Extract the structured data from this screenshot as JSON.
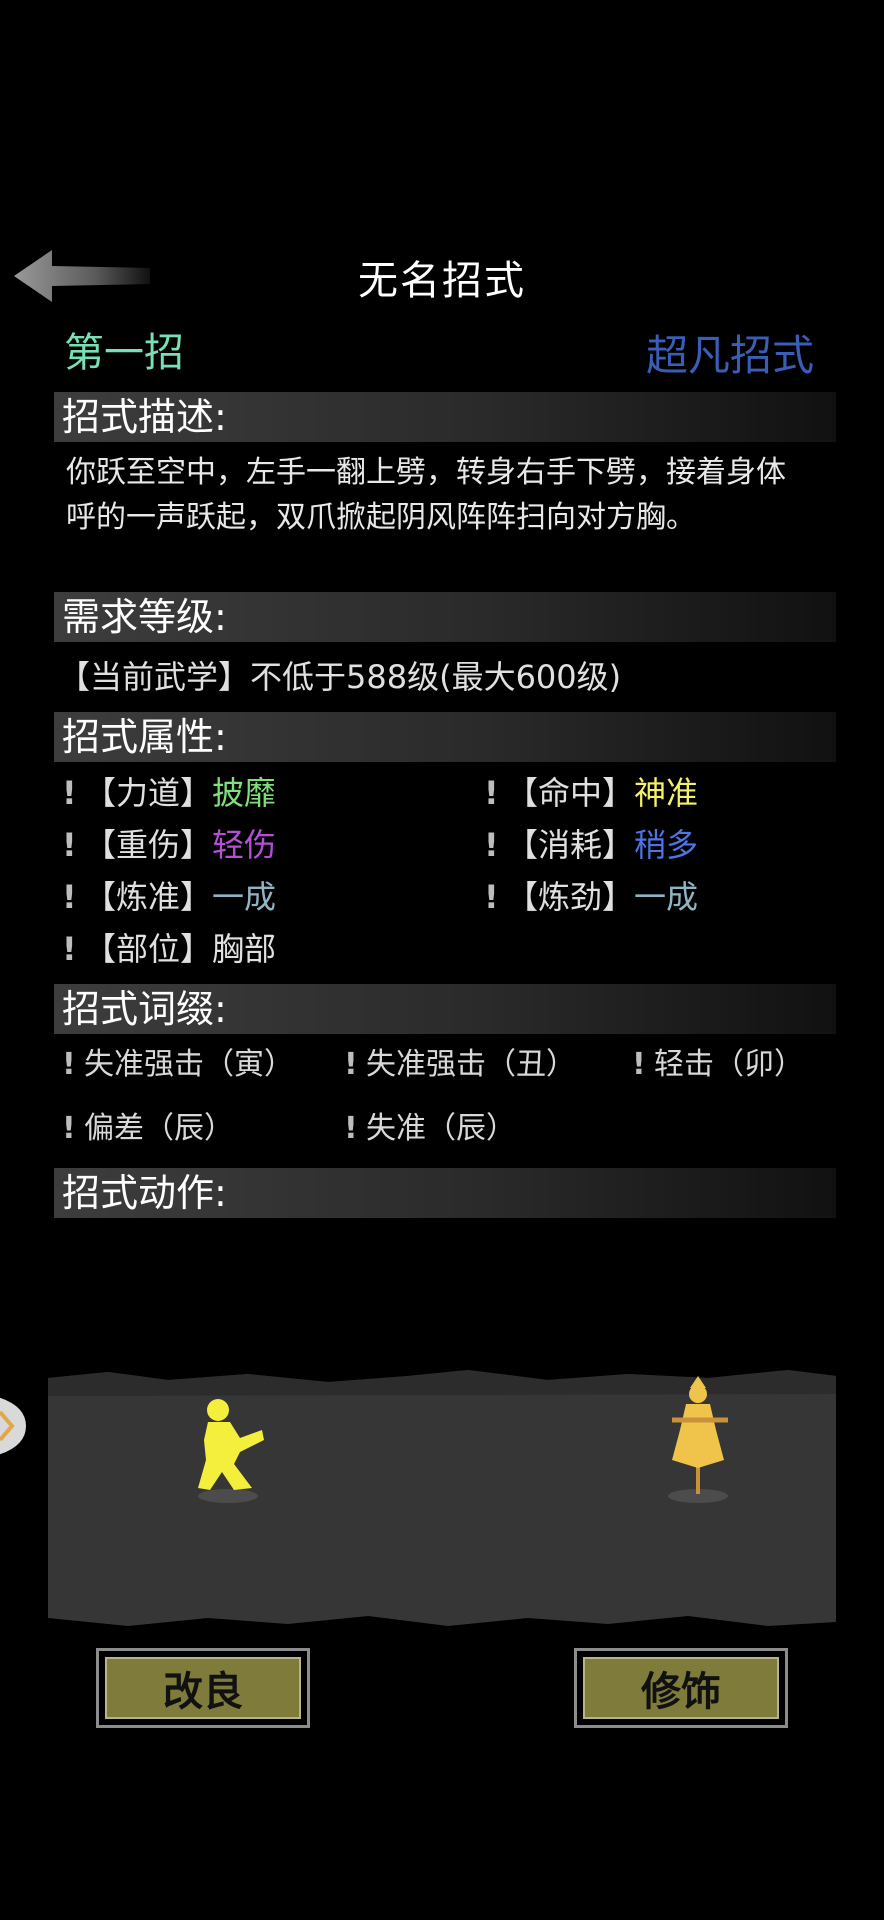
{
  "header": {
    "title": "无名招式"
  },
  "move": {
    "index_label": "第一招",
    "tier_label": "超凡招式",
    "index_color": "#78e0b5",
    "tier_color": "#3a5db8"
  },
  "sections": {
    "description_title": "招式描述:",
    "requirement_title": "需求等级:",
    "attributes_title": "招式属性:",
    "affixes_title": "招式词缀:",
    "animation_title": "招式动作:"
  },
  "description": "你跃至空中，左手一翻上劈，转身右手下劈，接着身体呼的一声跃起，双爪掀起阴风阵阵扫向对方胸。",
  "requirement": "【当前武学】不低于588级(最大600级)",
  "attributes": [
    {
      "bang": "!",
      "key": "【力道】",
      "value": "披靡",
      "color": "#7fe07a"
    },
    {
      "bang": "!",
      "key": "【命中】",
      "value": "神准",
      "color": "#f5f06a"
    },
    {
      "bang": "!",
      "key": "【重伤】",
      "value": "轻伤",
      "color": "#b44fd6"
    },
    {
      "bang": "!",
      "key": "【消耗】",
      "value": "稍多",
      "color": "#4f74e8"
    },
    {
      "bang": "!",
      "key": "【炼准】",
      "value": "一成",
      "color": "#8fb5c4"
    },
    {
      "bang": "!",
      "key": "【炼劲】",
      "value": "一成",
      "color": "#8fb5c4"
    },
    {
      "bang": "!",
      "key": "【部位】",
      "value": "胸部",
      "color": "#e0e0e0"
    }
  ],
  "affixes": [
    {
      "bang": "!",
      "label": "失准强击（寅）"
    },
    {
      "bang": "!",
      "label": "失准强击（丑）"
    },
    {
      "bang": "!",
      "label": "轻击（卯）"
    },
    {
      "bang": "!",
      "label": "偏差（辰）"
    },
    {
      "bang": "!",
      "label": "失准（辰）"
    }
  ],
  "buttons": {
    "improve": "改良",
    "decorate": "修饰"
  }
}
